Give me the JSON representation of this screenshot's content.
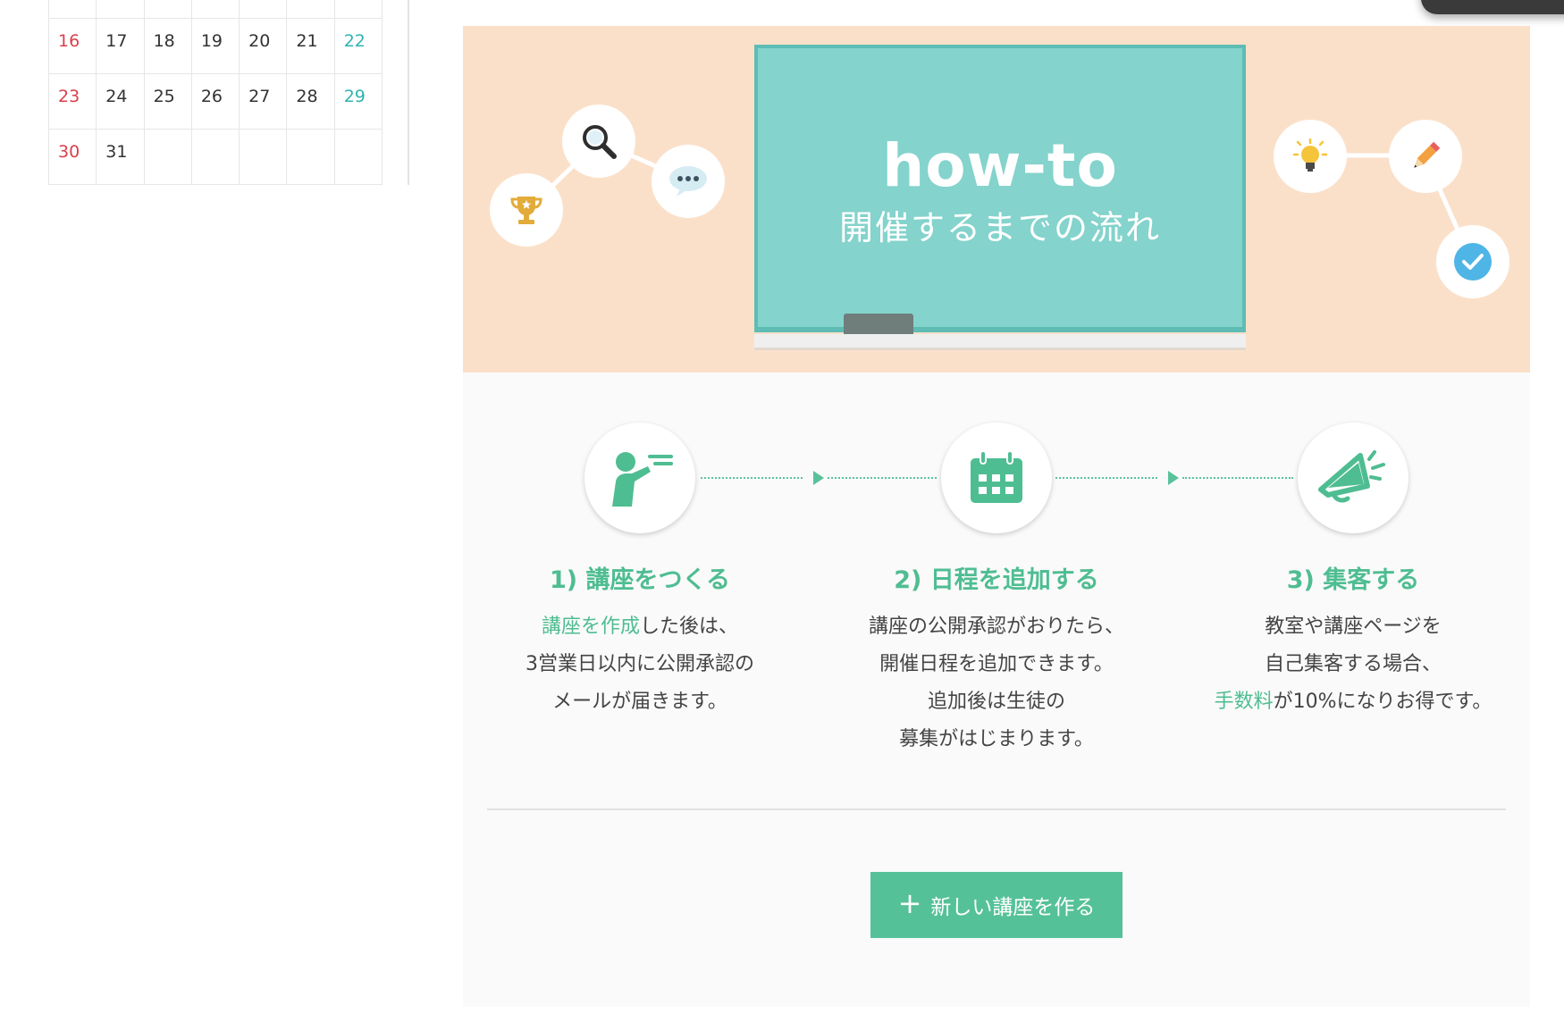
{
  "calendar": {
    "rows": [
      [
        "",
        "",
        "",
        "",
        "",
        "",
        ""
      ],
      [
        "16",
        "17",
        "18",
        "19",
        "20",
        "21",
        "22"
      ],
      [
        "23",
        "24",
        "25",
        "26",
        "27",
        "28",
        "29"
      ],
      [
        "30",
        "31",
        "",
        "",
        "",
        "",
        ""
      ]
    ]
  },
  "hero": {
    "title": "how-to",
    "subtitle": "開催するまでの流れ"
  },
  "steps": [
    {
      "title": "1) 講座をつくる",
      "desc_link": "講座を作成",
      "desc_after_link": "した後は、",
      "desc_line2": "3営業日以内に公開承認の",
      "desc_line3": "メールが届きます。"
    },
    {
      "title": "2) 日程を追加する",
      "desc_line1": "講座の公開承認がおりたら、",
      "desc_line2": "開催日程を追加できます。",
      "desc_line3": "追加後は生徒の",
      "desc_line4": "募集がはじまります。"
    },
    {
      "title": "3) 集客する",
      "desc_line1": "教室や講座ページを",
      "desc_line2": "自己集客する場合、",
      "desc_link": "手数料",
      "desc_after_link": "が10%になりお得です。"
    }
  ],
  "cta": {
    "plus": "+",
    "label": "新しい講座を作る"
  },
  "colors": {
    "accent": "#55c199",
    "hero_bg": "#fbe0c9",
    "board": "#84d3cc",
    "sunday": "#d9404b",
    "saturday": "#2fb3b0"
  },
  "icons": [
    "trophy-icon",
    "magnifier-icon",
    "speech-bubble-icon",
    "lightbulb-icon",
    "pencil-icon",
    "check-icon",
    "teacher-icon",
    "calendar-icon",
    "megaphone-icon"
  ]
}
